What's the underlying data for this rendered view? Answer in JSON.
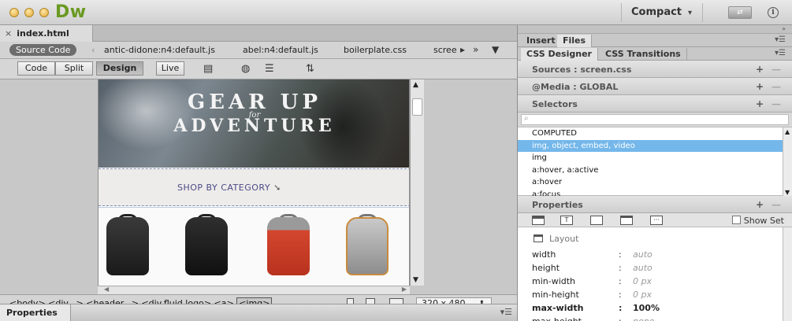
{
  "app": {
    "logo": "Dw",
    "workspace": "Compact",
    "sync_label": "⇄",
    "info_label": "i"
  },
  "document": {
    "tab": "index.html",
    "source_code_label": "Source Code",
    "related_files": [
      "antic-didone:n4:default.js",
      "abel:n4:default.js",
      "boilerplate.css",
      "scree"
    ],
    "views": {
      "code": "Code",
      "split": "Split",
      "design": "Design",
      "live": "Live"
    },
    "page": {
      "headline_1": "GEAR UP",
      "headline_for": "for",
      "headline_2": "ADVENTURE",
      "shop": "SHOP BY CATEGORY"
    },
    "status": {
      "tags": [
        "<body>",
        "<div...>",
        "<header...>",
        "<div.fluid.logo>",
        "<a>"
      ],
      "current_tag": "<img>",
      "size": "320 x 480"
    }
  },
  "properties_panel": {
    "tab": "Properties"
  },
  "panel": {
    "tabs": [
      "Insert",
      "Files"
    ],
    "sub_tabs": [
      "CSS Designer",
      "CSS Transitions"
    ],
    "sources": "Sources : screen.css",
    "media": "@Media : GLOBAL",
    "selectors": "Selectors",
    "selector_list": [
      "COMPUTED",
      "img, object, embed, video",
      "img",
      "a:hover, a:active",
      "a:hover",
      "a:focus"
    ],
    "selected_index": 1,
    "properties": "Properties",
    "show_set": "Show Set",
    "layout": "Layout",
    "props": [
      {
        "name": "width",
        "value": "auto",
        "bold": false
      },
      {
        "name": "height",
        "value": "auto",
        "bold": false
      },
      {
        "name": "min-width",
        "value": "0 px",
        "bold": false
      },
      {
        "name": "min-height",
        "value": "0 px",
        "bold": false
      },
      {
        "name": "max-width",
        "value": "100%",
        "bold": true
      },
      {
        "name": "max-height",
        "value": "none",
        "bold": false
      }
    ]
  },
  "colors": {
    "accent": "#74b7ea",
    "logo": "#6a9a22",
    "shop_text": "#4b4a86"
  },
  "icons": [
    "close-icon",
    "filter-icon",
    "globe-icon",
    "toggle-list-icon",
    "sort-icon",
    "mobile-size-icon",
    "tablet-size-icon",
    "desktop-size-icon",
    "add-icon",
    "remove-icon"
  ]
}
